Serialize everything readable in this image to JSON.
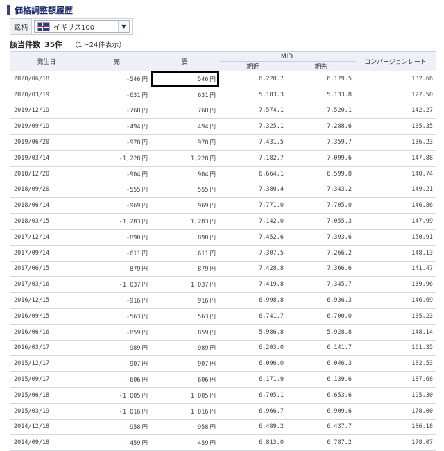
{
  "header": {
    "title": "価格調整額履歴"
  },
  "filter": {
    "label": "銘柄",
    "selected": "イギリス100",
    "flag_icon": "uk-flag-icon"
  },
  "summary": {
    "label": "該当件数",
    "count": "35件",
    "range": "（1〜24件表示）"
  },
  "table": {
    "columns": {
      "date": "発生日",
      "sell": "売",
      "buy": "買",
      "mid": "MID",
      "near": "期近",
      "far": "期先",
      "rate": "コンバージョンレート"
    },
    "rows": [
      {
        "date": "2020/06/18",
        "sell": "-546",
        "sell_unit": "円",
        "buy": "546",
        "buy_unit": "円",
        "near": "6,220.7",
        "far": "6,179.5",
        "rate": "132.66"
      },
      {
        "date": "2020/03/19",
        "sell": "-631",
        "sell_unit": "円",
        "buy": "631",
        "buy_unit": "円",
        "near": "5,183.3",
        "far": "5,133.8",
        "rate": "127.50"
      },
      {
        "date": "2019/12/19",
        "sell": "-768",
        "sell_unit": "円",
        "buy": "768",
        "buy_unit": "円",
        "near": "7,574.1",
        "far": "7,520.1",
        "rate": "142.27"
      },
      {
        "date": "2019/09/19",
        "sell": "-494",
        "sell_unit": "円",
        "buy": "494",
        "buy_unit": "円",
        "near": "7,325.1",
        "far": "7,288.6",
        "rate": "135.35"
      },
      {
        "date": "2019/06/20",
        "sell": "-978",
        "sell_unit": "円",
        "buy": "978",
        "buy_unit": "円",
        "near": "7,431.5",
        "far": "7,359.7",
        "rate": "136.23"
      },
      {
        "date": "2019/03/14",
        "sell": "-1,228",
        "sell_unit": "円",
        "buy": "1,228",
        "buy_unit": "円",
        "near": "7,182.7",
        "far": "7,099.6",
        "rate": "147.88"
      },
      {
        "date": "2018/12/20",
        "sell": "-904",
        "sell_unit": "円",
        "buy": "904",
        "buy_unit": "円",
        "near": "6,664.1",
        "far": "6,599.8",
        "rate": "140.74"
      },
      {
        "date": "2018/09/20",
        "sell": "-555",
        "sell_unit": "円",
        "buy": "555",
        "buy_unit": "円",
        "near": "7,380.4",
        "far": "7,343.2",
        "rate": "149.21"
      },
      {
        "date": "2018/06/14",
        "sell": "-969",
        "sell_unit": "円",
        "buy": "969",
        "buy_unit": "円",
        "near": "7,771.0",
        "far": "7,705.0",
        "rate": "146.86"
      },
      {
        "date": "2018/03/15",
        "sell": "-1,283",
        "sell_unit": "円",
        "buy": "1,283",
        "buy_unit": "円",
        "near": "7,142.0",
        "far": "7,055.3",
        "rate": "147.99"
      },
      {
        "date": "2017/12/14",
        "sell": "-890",
        "sell_unit": "円",
        "buy": "890",
        "buy_unit": "円",
        "near": "7,452.6",
        "far": "7,393.6",
        "rate": "150.91"
      },
      {
        "date": "2017/09/14",
        "sell": "-611",
        "sell_unit": "円",
        "buy": "611",
        "buy_unit": "円",
        "near": "7,307.5",
        "far": "7,266.2",
        "rate": "148.13"
      },
      {
        "date": "2017/06/15",
        "sell": "-879",
        "sell_unit": "円",
        "buy": "879",
        "buy_unit": "円",
        "near": "7,428.8",
        "far": "7,366.6",
        "rate": "141.47"
      },
      {
        "date": "2017/03/16",
        "sell": "-1,037",
        "sell_unit": "円",
        "buy": "1,037",
        "buy_unit": "円",
        "near": "7,419.8",
        "far": "7,345.7",
        "rate": "139.96"
      },
      {
        "date": "2016/12/15",
        "sell": "-916",
        "sell_unit": "円",
        "buy": "916",
        "buy_unit": "円",
        "near": "6,998.8",
        "far": "6,936.3",
        "rate": "146.69"
      },
      {
        "date": "2016/09/15",
        "sell": "-563",
        "sell_unit": "円",
        "buy": "563",
        "buy_unit": "円",
        "near": "6,741.7",
        "far": "6,700.0",
        "rate": "135.23"
      },
      {
        "date": "2016/06/16",
        "sell": "-859",
        "sell_unit": "円",
        "buy": "859",
        "buy_unit": "円",
        "near": "5,986.8",
        "far": "5,928.8",
        "rate": "148.14"
      },
      {
        "date": "2016/03/17",
        "sell": "-989",
        "sell_unit": "円",
        "buy": "989",
        "buy_unit": "円",
        "near": "6,203.0",
        "far": "6,141.7",
        "rate": "161.35"
      },
      {
        "date": "2015/12/17",
        "sell": "-907",
        "sell_unit": "円",
        "buy": "907",
        "buy_unit": "円",
        "near": "6,096.0",
        "far": "6,046.3",
        "rate": "182.53"
      },
      {
        "date": "2015/09/17",
        "sell": "-606",
        "sell_unit": "円",
        "buy": "606",
        "buy_unit": "円",
        "near": "6,171.9",
        "far": "6,139.6",
        "rate": "187.68"
      },
      {
        "date": "2015/06/18",
        "sell": "-1,005",
        "sell_unit": "円",
        "buy": "1,005",
        "buy_unit": "円",
        "near": "6,705.1",
        "far": "6,653.6",
        "rate": "195.30"
      },
      {
        "date": "2015/03/19",
        "sell": "-1,016",
        "sell_unit": "円",
        "buy": "1,016",
        "buy_unit": "円",
        "near": "6,966.7",
        "far": "6,909.6",
        "rate": "178.00"
      },
      {
        "date": "2014/12/18",
        "sell": "-958",
        "sell_unit": "円",
        "buy": "958",
        "buy_unit": "円",
        "near": "6,489.2",
        "far": "6,437.7",
        "rate": "186.18"
      },
      {
        "date": "2014/09/18",
        "sell": "-459",
        "sell_unit": "円",
        "buy": "459",
        "buy_unit": "円",
        "near": "6,813.0",
        "far": "6,787.2",
        "rate": "178.07"
      }
    ]
  }
}
